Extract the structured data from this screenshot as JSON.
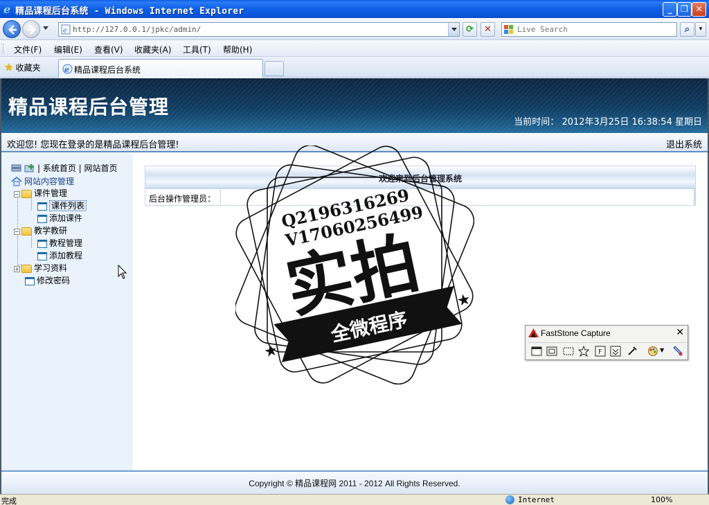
{
  "window": {
    "title": "精品课程后台系统 - Windows Internet Explorer",
    "address": "http://127.0.0.1/jpkc/admin/",
    "search_placeholder": "Live Search"
  },
  "menu": [
    "文件(F)",
    "编辑(E)",
    "查看(V)",
    "收藏夹(A)",
    "工具(T)",
    "帮助(H)"
  ],
  "favorites_label": "收藏夹",
  "tab_title": "精品课程后台系统",
  "header": {
    "site_title": "精品课程后台管理",
    "time_label": "当前时间：",
    "time_value": "2012年3月25日 16:38:54 星期日"
  },
  "welcome": {
    "message": "欢迎您! 您现在登录的是精品课程后台管理!",
    "logout": "退出系统"
  },
  "sidebar": {
    "top_links": "| 系统首页 | 网站首页",
    "root": "网站内容管理",
    "groups": [
      {
        "label": "课件管理",
        "items": [
          "课件列表",
          "添加课件"
        ]
      },
      {
        "label": "教学教研",
        "items": [
          "教程管理",
          "添加教程"
        ]
      },
      {
        "label": "学习资料",
        "items": []
      }
    ],
    "change_password": "修改密码"
  },
  "main": {
    "panel_title": "欢迎来到后台管理系统",
    "admin_label": "后台操作管理员：",
    "admin_value": ""
  },
  "footer": "Copyright © 精品课程网  2011 - 2012 All Rights Reserved.",
  "statusbar": {
    "status": "完成",
    "zone": "Internet",
    "zoom": "100%"
  },
  "watermark": {
    "line1": "Q2196316269",
    "line2": "V17060256499",
    "big": "实拍",
    "banner": "全微程序"
  },
  "faststone": {
    "title": "FastStone Capture"
  },
  "icons": {
    "browser": "ie-icon",
    "back": "back-arrow-icon",
    "refresh": "refresh-icon",
    "stop": "stop-icon",
    "search": "search-icon",
    "favorites": "star-icon",
    "folder": "folder-icon",
    "document": "document-icon",
    "globe": "globe-icon"
  },
  "colors": {
    "titlebar": "#0a5ee8",
    "banner": "#0f3c63",
    "sidebar_bg": "#eaf3fc",
    "accent_border": "#5b8cc0"
  }
}
